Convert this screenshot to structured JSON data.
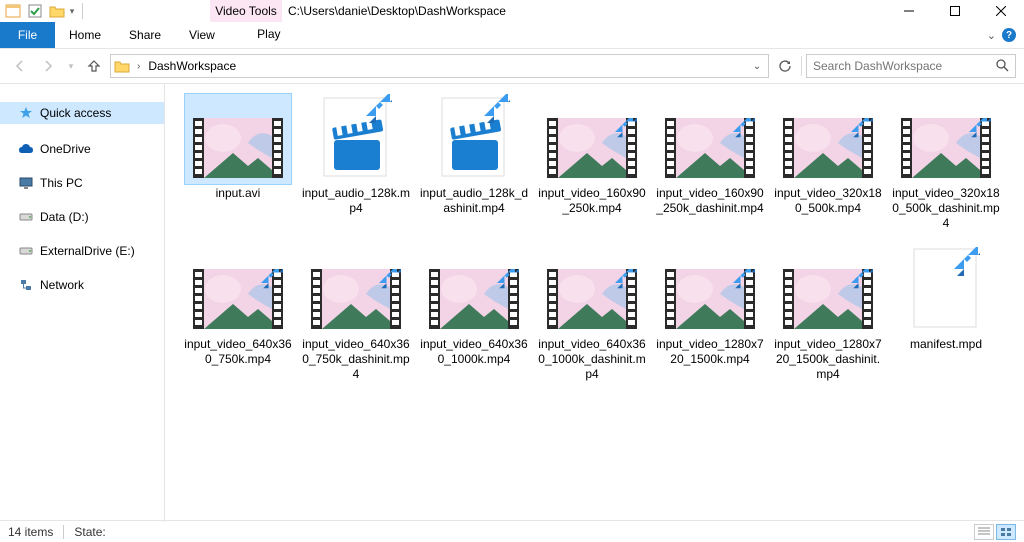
{
  "title_path": "C:\\Users\\danie\\Desktop\\DashWorkspace",
  "contextual_tab_group": "Video Tools",
  "ribbon": {
    "file": "File",
    "home": "Home",
    "share": "Share",
    "view": "View",
    "play": "Play"
  },
  "breadcrumb": {
    "segment": "DashWorkspace"
  },
  "search_placeholder": "Search DashWorkspace",
  "sidebar": {
    "quick": "Quick access",
    "onedrive": "OneDrive",
    "thispc": "This PC",
    "data": "Data (D:)",
    "external": "ExternalDrive (E:)",
    "network": "Network"
  },
  "files": [
    {
      "name": "input.avi",
      "type": "video",
      "selected": true
    },
    {
      "name": "input_audio_128k.mp4",
      "type": "clapper"
    },
    {
      "name": "input_audio_128k_dashinit.mp4",
      "type": "clapper"
    },
    {
      "name": "input_video_160x90_250k.mp4",
      "type": "video"
    },
    {
      "name": "input_video_160x90_250k_dashinit.mp4",
      "type": "video"
    },
    {
      "name": "input_video_320x180_500k.mp4",
      "type": "video"
    },
    {
      "name": "input_video_320x180_500k_dashinit.mp4",
      "type": "video"
    },
    {
      "name": "input_video_640x360_750k.mp4",
      "type": "video"
    },
    {
      "name": "input_video_640x360_750k_dashinit.mp4",
      "type": "video"
    },
    {
      "name": "input_video_640x360_1000k.mp4",
      "type": "video"
    },
    {
      "name": "input_video_640x360_1000k_dashinit.mp4",
      "type": "video"
    },
    {
      "name": "input_video_1280x720_1500k.mp4",
      "type": "video"
    },
    {
      "name": "input_video_1280x720_1500k_dashinit.mp4",
      "type": "video"
    },
    {
      "name": "manifest.mpd",
      "type": "file"
    }
  ],
  "status": {
    "count": "14 items",
    "state_label": "State:"
  }
}
